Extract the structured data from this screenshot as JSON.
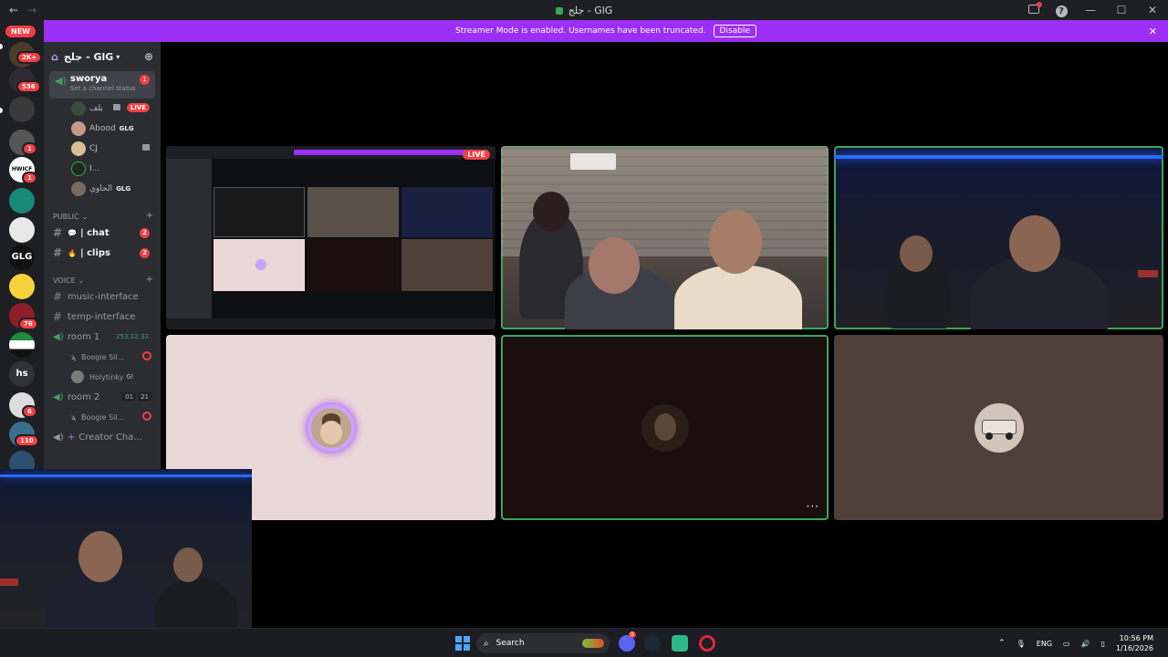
{
  "titlebar": {
    "title": "جلج - GlG",
    "back_icon": "arrow-left-icon",
    "forward_icon": "arrow-right-icon"
  },
  "rail": {
    "new_label": "NEW",
    "badges": [
      "2K+",
      "536",
      "1",
      "1",
      "76",
      "6",
      "110"
    ],
    "glg_label": "GLG",
    "hs_label": "hs",
    "nt_label": "HWICF"
  },
  "banner": {
    "message": "Streamer Mode is enabled. Usernames have been truncated.",
    "disable_label": "Disable"
  },
  "sidebar": {
    "server_name": "جلج - GlG",
    "active_channel": {
      "name": "sworya",
      "status": "Set a channel status",
      "badge": "1"
    },
    "members": [
      {
        "name": "يلف",
        "live": "LIVE",
        "tag": ""
      },
      {
        "name": "Abood",
        "live": "",
        "tag": "GLG"
      },
      {
        "name": "CJ",
        "live": "",
        "tag": ""
      },
      {
        "name": "I...",
        "live": "",
        "tag": ""
      },
      {
        "name": "الحاوي",
        "live": "",
        "tag": "GLG"
      }
    ],
    "public_label": "PUBLIC",
    "text_channels": [
      {
        "name": "| chat",
        "badge": "2"
      },
      {
        "name": "| clips",
        "badge": "2"
      }
    ],
    "voice_label": "VOICE",
    "voice_text_channels": [
      "music-interface",
      "temp-interface"
    ],
    "room1": {
      "name": "room 1",
      "timer": "253:22:33"
    },
    "room1_members": [
      {
        "name": "Boogie Sil...",
        "tag": ""
      },
      {
        "name": "Holytinky",
        "tag": "Gl"
      }
    ],
    "room2": {
      "name": "room 2",
      "count_a": "01",
      "count_b": "21"
    },
    "room2_members": [
      {
        "name": "Boogie Sil..."
      }
    ],
    "creator_channel": "Creator Cha..."
  },
  "grid": {
    "live_label": "LIVE",
    "more_label": "···"
  },
  "taskbar": {
    "search_placeholder": "Search",
    "discord_badge": "9",
    "lang": "ENG",
    "time": "10:56 PM",
    "date": "1/16/2026"
  },
  "colors": {
    "accent": "#9b2ff5",
    "speaking": "#3ba55d",
    "badge": "#f23f43",
    "tile_pink": "#ead7d8",
    "tile_dark": "#1a0f0c",
    "tile_brown": "#4f4039"
  }
}
